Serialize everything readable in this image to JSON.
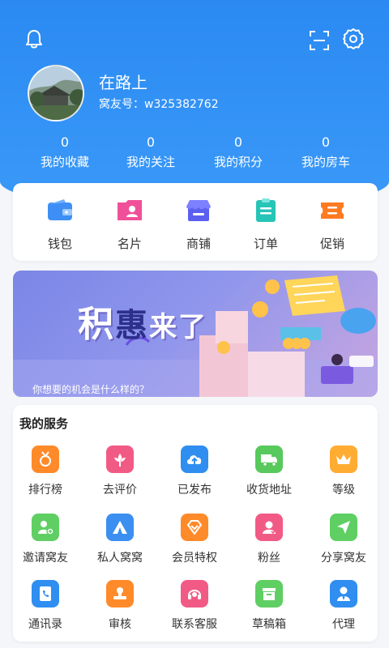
{
  "header": {
    "username": "在路上",
    "user_id": "窝友号：w325382762"
  },
  "stats": [
    {
      "value": "0",
      "label": "我的收藏"
    },
    {
      "value": "0",
      "label": "我的关注"
    },
    {
      "value": "0",
      "label": "我的积分"
    },
    {
      "value": "0",
      "label": "我的房车"
    }
  ],
  "wallet_bar": [
    {
      "label": "钱包",
      "icon": "wallet-icon",
      "color": "#3d8ff5"
    },
    {
      "label": "名片",
      "icon": "card-icon",
      "color": "#f0509a"
    },
    {
      "label": "商铺",
      "icon": "shop-icon",
      "color": "#5b5ff0"
    },
    {
      "label": "订单",
      "icon": "order-icon",
      "color": "#27c4b8"
    },
    {
      "label": "促销",
      "icon": "promo-icon",
      "color": "#ff7a21"
    }
  ],
  "banner": {
    "title_1": "积",
    "title_2": "惠",
    "title_3": "来了",
    "subtitle": "你想要的机会是什么样的？"
  },
  "services": {
    "title": "我的服务",
    "items": [
      {
        "label": "排行榜",
        "icon": "medal-icon",
        "color": "#ff8a2a"
      },
      {
        "label": "去评价",
        "icon": "flower-icon",
        "color": "#f25a86"
      },
      {
        "label": "已发布",
        "icon": "cloud-upload-icon",
        "color": "#2f8ef0"
      },
      {
        "label": "收货地址",
        "icon": "truck-icon",
        "color": "#58c95c"
      },
      {
        "label": "等级",
        "icon": "crown-icon",
        "color": "#ffac33"
      },
      {
        "label": "邀请窝友",
        "icon": "user-add-icon",
        "color": "#5fcf63"
      },
      {
        "label": "私人窝窝",
        "icon": "tent-icon",
        "color": "#3a8ff0"
      },
      {
        "label": "会员特权",
        "icon": "diamond-icon",
        "color": "#ff8a2a"
      },
      {
        "label": "粉丝",
        "icon": "fans-icon",
        "color": "#f25a86"
      },
      {
        "label": "分享窝友",
        "icon": "send-icon",
        "color": "#5fcf63"
      },
      {
        "label": "通讯录",
        "icon": "phone-book-icon",
        "color": "#2f8ef0"
      },
      {
        "label": "审核",
        "icon": "stamp-icon",
        "color": "#ff8a2a"
      },
      {
        "label": "联系客服",
        "icon": "headset-icon",
        "color": "#f25a86"
      },
      {
        "label": "草稿箱",
        "icon": "box-icon",
        "color": "#5fcf63"
      },
      {
        "label": "代理",
        "icon": "agent-icon",
        "color": "#2f8ef0"
      }
    ]
  }
}
